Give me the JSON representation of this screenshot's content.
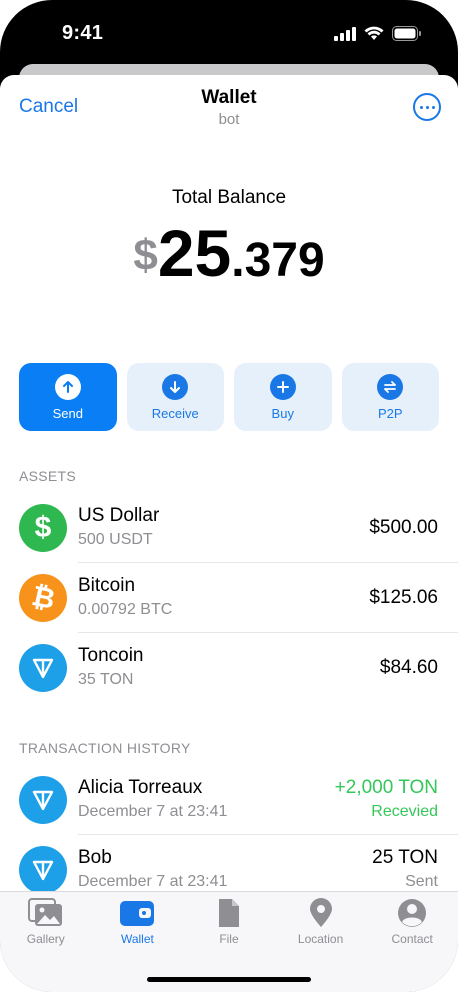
{
  "status_bar": {
    "time": "9:41"
  },
  "nav": {
    "cancel_label": "Cancel",
    "title": "Wallet",
    "subtitle": "bot"
  },
  "balance": {
    "label": "Total Balance",
    "currency": "$",
    "integer": "25",
    "decimal": ".379"
  },
  "actions": [
    {
      "label": "Send"
    },
    {
      "label": "Receive"
    },
    {
      "label": "Buy"
    },
    {
      "label": "P2P"
    }
  ],
  "assets": {
    "header": "ASSETS",
    "items": [
      {
        "name": "US Dollar",
        "amount": "500 USDT",
        "value": "$500.00",
        "icon": "dollar-icon",
        "color": "#2fb84f"
      },
      {
        "name": "Bitcoin",
        "amount": "0.00792 BTC",
        "value": "$125.06",
        "icon": "bitcoin-icon",
        "color": "#f7931a"
      },
      {
        "name": "Toncoin",
        "amount": "35 TON",
        "value": "$84.60",
        "icon": "toncoin-icon",
        "color": "#1ea0e8"
      }
    ]
  },
  "transactions": {
    "header": "TRANSACTION HISTORY",
    "items": [
      {
        "name": "Alicia Torreaux",
        "date": "December 7 at 23:41",
        "amount": "+2,000 TON",
        "status": "Recevied",
        "icon": "toncoin-icon"
      },
      {
        "name": "Bob",
        "date": "December 7 at 23:41",
        "amount": "25 TON",
        "status": "Sent",
        "icon": "toncoin-icon"
      }
    ]
  },
  "tabs": [
    {
      "label": "Gallery",
      "icon": "gallery-icon"
    },
    {
      "label": "Wallet",
      "icon": "wallet-icon",
      "active": true
    },
    {
      "label": "File",
      "icon": "file-icon"
    },
    {
      "label": "Location",
      "icon": "location-icon"
    },
    {
      "label": "Contact",
      "icon": "contact-icon"
    }
  ],
  "colors": {
    "accent": "#1a78e6",
    "primary_button": "#0a7ff5",
    "positive": "#34c759"
  }
}
